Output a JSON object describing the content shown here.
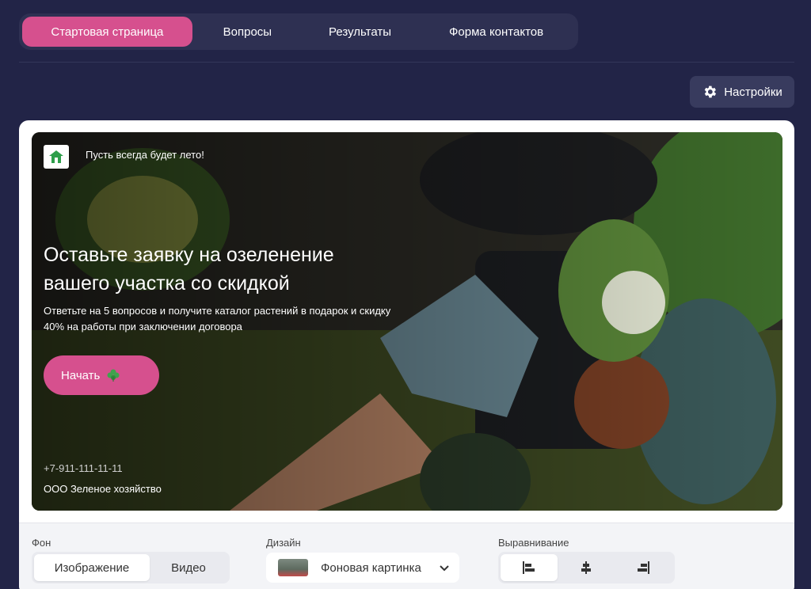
{
  "nav": {
    "tabs": [
      {
        "label": "Стартовая страница"
      },
      {
        "label": "Вопросы"
      },
      {
        "label": "Результаты"
      },
      {
        "label": "Форма контактов"
      }
    ]
  },
  "settings": {
    "label": "Настройки",
    "icon": "gear-icon"
  },
  "hero": {
    "tagline": "Пусть всегда будет лето!",
    "headline": "Оставьте заявку на озеленение вашего участка со скидкой",
    "subtext": "Ответьте на 5 вопросов и получите каталог растений в подарок и скидку 40% на работы при заключении договора",
    "start_label": "Начать",
    "start_icon": "clover-icon",
    "phone": "+7-911-111-11-11",
    "company": "ООО Зеленое хозяйство"
  },
  "panel": {
    "background": {
      "label": "Фон",
      "options": [
        "Изображение",
        "Видео"
      ],
      "selected": "Изображение"
    },
    "design": {
      "label": "Дизайн",
      "value": "Фоновая картинка"
    },
    "align": {
      "label": "Выравнивание",
      "options": [
        "align-left-icon",
        "align-center-icon",
        "align-right-icon"
      ],
      "selected": "align-left-icon"
    }
  },
  "colors": {
    "accent": "#d6508e",
    "page_bg": "#222447",
    "nav_bg": "#2e3052"
  }
}
